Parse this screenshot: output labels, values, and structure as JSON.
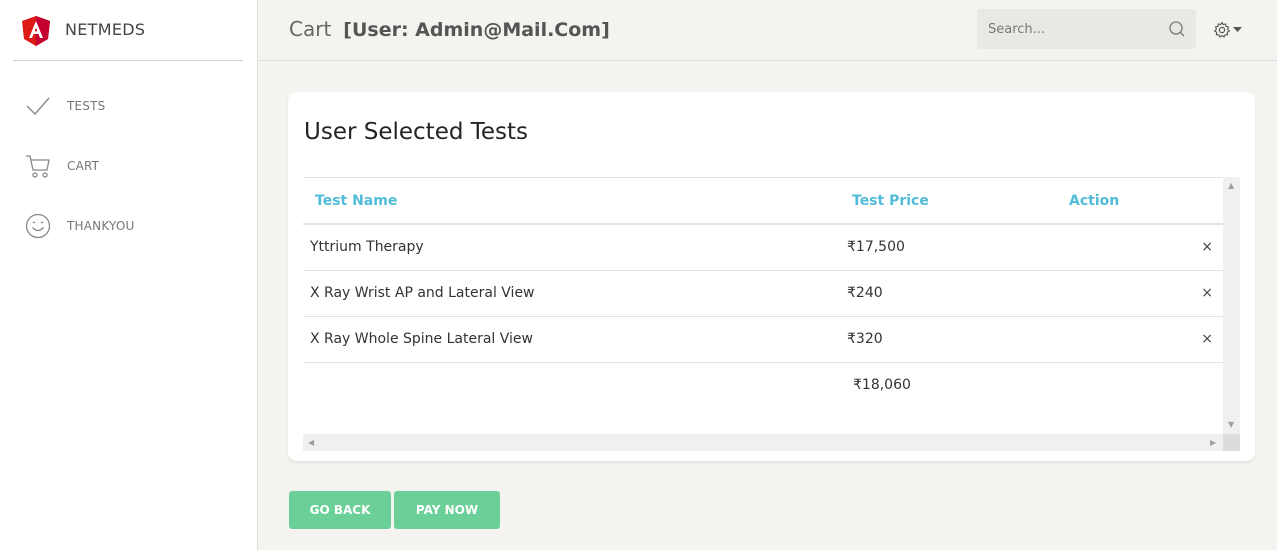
{
  "app": {
    "name": "NETMEDS",
    "brand_color": "#dd1b16"
  },
  "sidebar": {
    "items": [
      {
        "label": "TESTS",
        "icon": "check-icon"
      },
      {
        "label": "CART",
        "icon": "cart-icon"
      },
      {
        "label": "THANKYOU",
        "icon": "smile-icon"
      }
    ]
  },
  "header": {
    "title": "Cart",
    "user": "[User: Admin@Mail.Com]",
    "search_placeholder": "Search...",
    "settings_icon": "gear-icon"
  },
  "card": {
    "title": "User Selected Tests",
    "columns": [
      "Test Name",
      "Test Price",
      "Action"
    ],
    "rows": [
      {
        "name": "Yttrium Therapy",
        "price": "₹17,500",
        "action": "×"
      },
      {
        "name": "X Ray Wrist AP and Lateral View",
        "price": "₹240",
        "action": "×"
      },
      {
        "name": "X Ray Whole Spine Lateral View",
        "price": "₹320",
        "action": "×"
      }
    ],
    "total": "₹18,060"
  },
  "buttons": {
    "go_back": "GO BACK",
    "pay_now": "PAY NOW"
  },
  "colors": {
    "accent_header": "#51bcda",
    "button": "#6bd098",
    "background": "#f4f3ef"
  }
}
